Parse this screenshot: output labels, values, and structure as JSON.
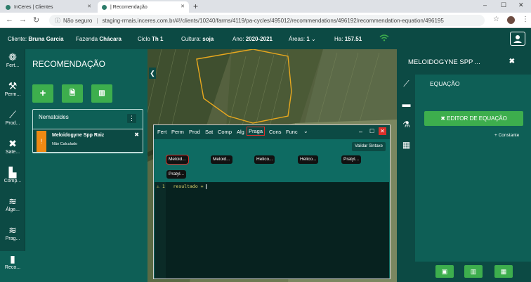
{
  "browser": {
    "tabs": [
      {
        "label": "InCeres | Clientes",
        "active": false
      },
      {
        "label": "| Recomendação",
        "active": true
      }
    ],
    "new_tab": "+",
    "url_warning": "Não seguro",
    "url": "staging-rmais.inceres.com.br/#!/clients/10240/farms/4119/pa-cycles/495012/recommendations/496192/recommendation-equation/496195"
  },
  "header": {
    "cliente_label": "Cliente:",
    "cliente_value": "Bruna Garcia",
    "fazenda_label": "Fazenda",
    "fazenda_value": "Chácara",
    "ciclo_label": "Ciclo",
    "ciclo_value": "Th 1",
    "cultura_label": "Cultura:",
    "cultura_value": "soja",
    "ano_label": "Ano:",
    "ano_value": "2020-2021",
    "areas_label": "Áreas:",
    "areas_value": "1",
    "ha_label": "Ha:",
    "ha_value": "157.51"
  },
  "rail": [
    {
      "label": "Fert..."
    },
    {
      "label": "Perm..."
    },
    {
      "label": "Prod..."
    },
    {
      "label": "Sate..."
    },
    {
      "label": "Comp..."
    },
    {
      "label": "Álge..."
    },
    {
      "label": "Prag..."
    },
    {
      "label": "Reco..."
    }
  ],
  "recommendation": {
    "title": "RECOMENDAÇÃO",
    "group_title": "Nematoides",
    "kebab": "⋮",
    "item_name": "Meloidogyne Spp Raiz",
    "item_status": "Não Calculado",
    "item_flag": "!"
  },
  "editor": {
    "tabs": [
      "Fert",
      "Perm",
      "Prod",
      "Sat",
      "Comp",
      "Alg",
      "Praga",
      "Cons",
      "Func"
    ],
    "selected_tab": "Praga",
    "validate_label": "Validar Sintaxe",
    "chips": [
      "Meloid...",
      "Meloid...",
      "Helico...",
      "Helico...",
      "Pratyl...",
      "Pratyl..."
    ],
    "line_number": "1",
    "code": "resultado = "
  },
  "right_panel": {
    "title": "MELOIDOGYNE SPP ...",
    "section": "EQUAÇÃO",
    "editor_button": "EDITOR DE EQUAÇÃO",
    "constante": "+ Constante"
  }
}
